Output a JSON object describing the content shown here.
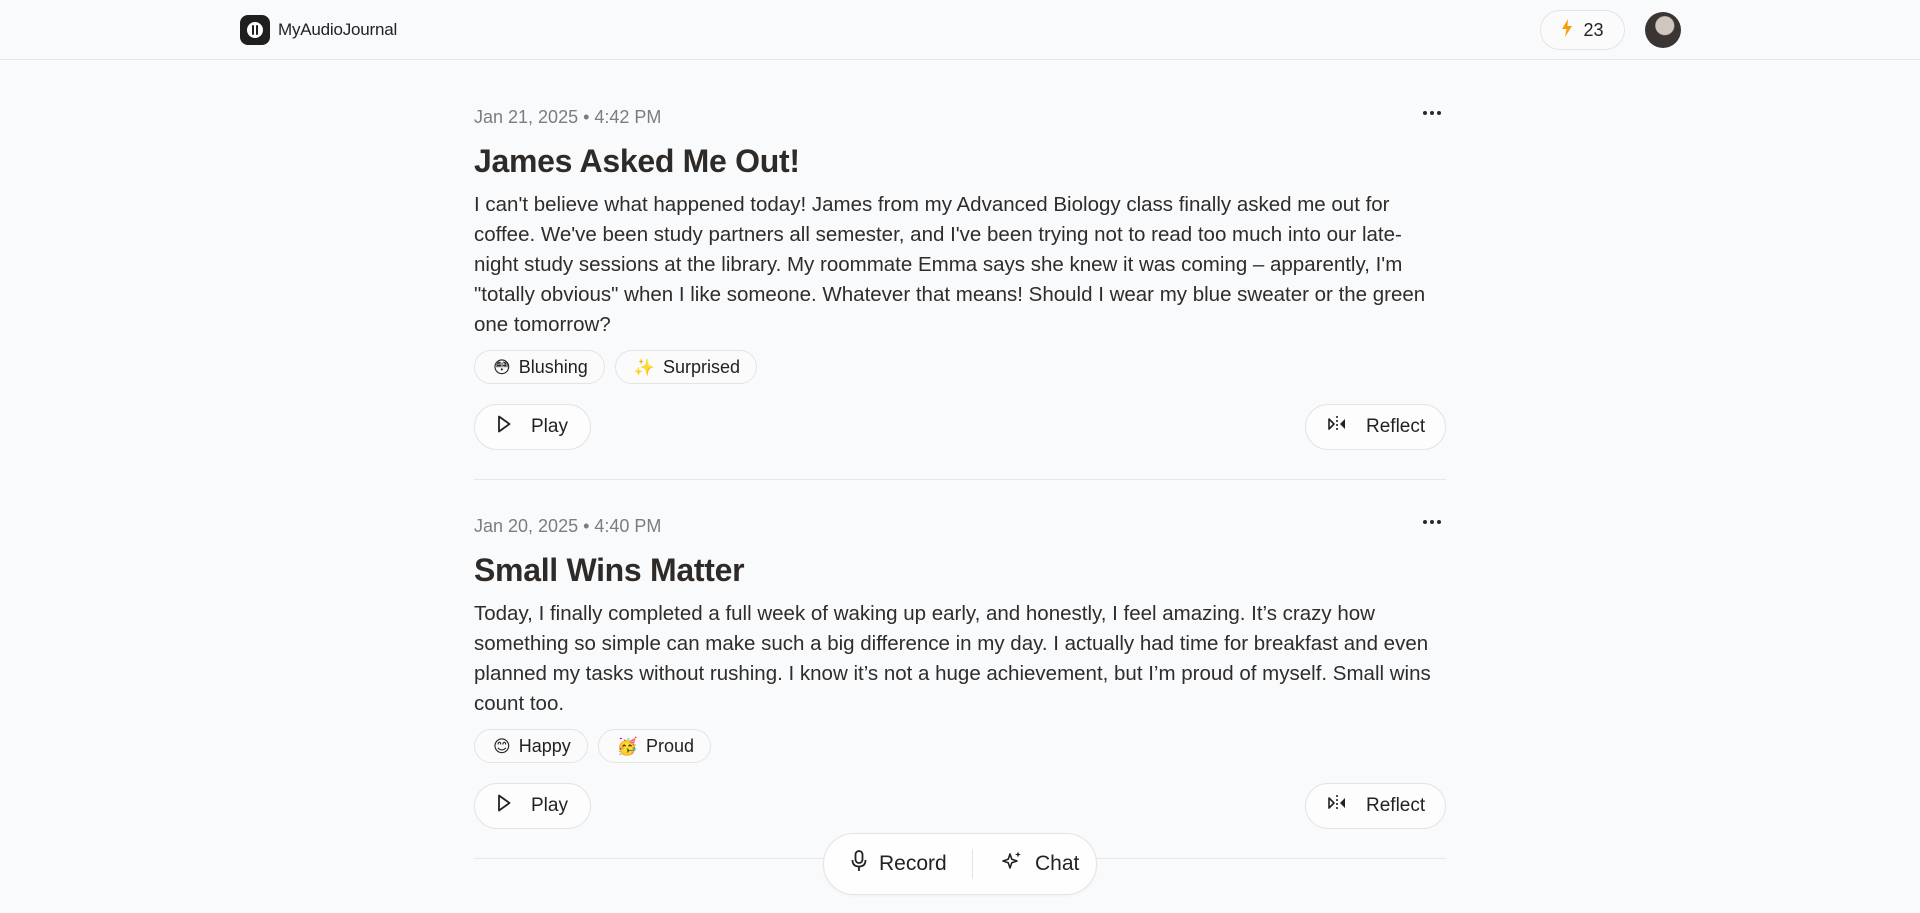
{
  "app": {
    "name": "MyAudioJournal",
    "logo_icon": "journal-logo-icon"
  },
  "header": {
    "streak_count": "23",
    "streak_icon": "lightning-icon",
    "accent": "#f59e0b"
  },
  "entries": [
    {
      "meta": "Jan 21, 2025 • 4:42 PM",
      "title": "James Asked Me Out!",
      "body": "I can't believe what happened today! James from my Advanced Biology class finally asked me out for coffee. We've been study partners all semester, and I've been trying not to read too much into our late-night study sessions at the library. My roommate Emma says she knew it was coming – apparently, I'm \"totally obvious\" when I like someone. Whatever that means! Should I wear my blue sweater or the green one tomorrow?",
      "tags": [
        {
          "emoji": "😳",
          "label": "Blushing"
        },
        {
          "emoji": "✨",
          "label": "Surprised"
        }
      ],
      "play_label": "Play",
      "reflect_label": "Reflect"
    },
    {
      "meta": "Jan 20, 2025 • 4:40 PM",
      "title": "Small Wins Matter",
      "body": "Today, I finally completed a full week of waking up early, and honestly, I feel amazing. It’s crazy how something so simple can make such a big difference in my day. I actually had time for breakfast and even planned my tasks without rushing. I know it’s not a huge achievement, but I’m proud of myself. Small wins count too.",
      "tags": [
        {
          "emoji": "😊",
          "label": "Happy"
        },
        {
          "emoji": "🥳",
          "label": "Proud"
        }
      ],
      "play_label": "Play",
      "reflect_label": "Reflect"
    }
  ],
  "dock": {
    "record_label": "Record",
    "chat_label": "Chat"
  }
}
